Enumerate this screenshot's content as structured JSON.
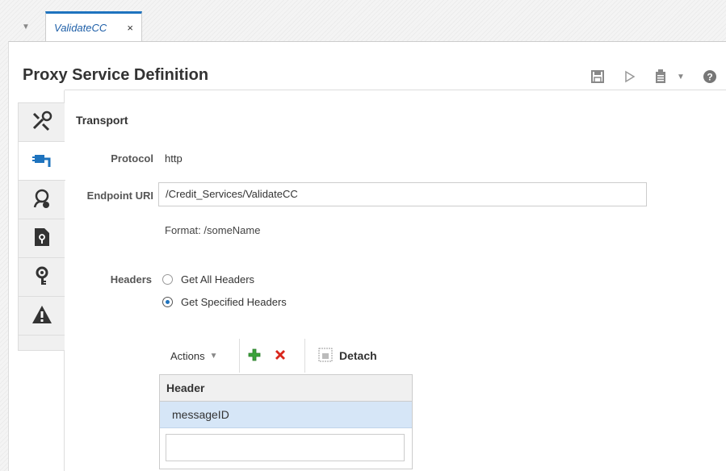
{
  "tab": {
    "label": "ValidateCC",
    "close": "×"
  },
  "page": {
    "title": "Proxy Service Definition"
  },
  "toolbar_icons": [
    "save-icon",
    "run-icon",
    "clipboard-icon",
    "dropdown-icon",
    "help-icon"
  ],
  "side_tabs": [
    "tools-icon",
    "transport-plug-icon",
    "security-user-icon",
    "policy-file-icon",
    "settings-key-icon",
    "warning-icon"
  ],
  "transport": {
    "section_title": "Transport",
    "protocol_label": "Protocol",
    "protocol_value": "http",
    "endpoint_label": "Endpoint URI",
    "endpoint_value": "/Credit_Services/ValidateCC",
    "format_hint": "Format: /someName",
    "headers_label": "Headers",
    "header_options": [
      "Get All Headers",
      "Get Specified Headers"
    ],
    "selected_option": "Get Specified Headers"
  },
  "headers_table": {
    "actions_label": "Actions",
    "detach_label": "Detach",
    "column_header": "Header",
    "rows": [
      "messageID"
    ]
  },
  "colors": {
    "accent": "#1e73be",
    "selected_row": "#d6e6f7",
    "add": "#3aa33a",
    "delete": "#d9261c"
  }
}
